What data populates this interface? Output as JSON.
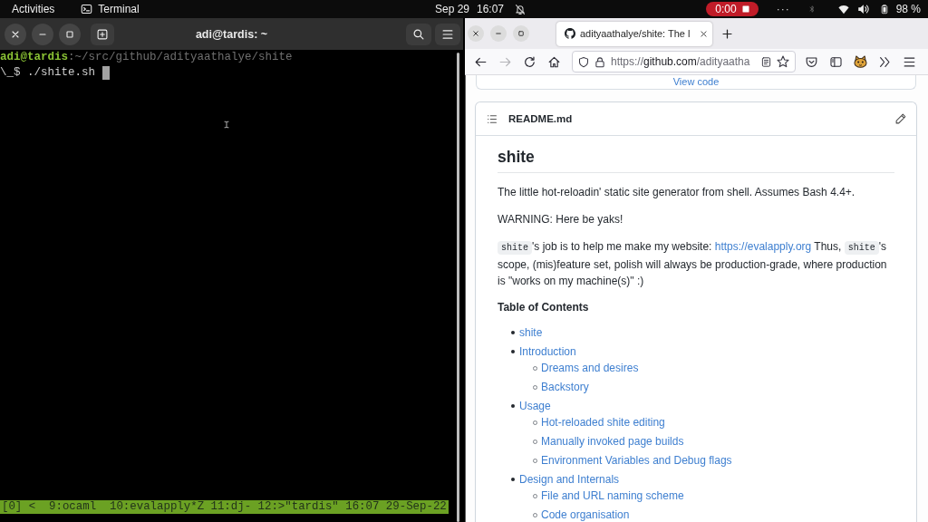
{
  "top_bar": {
    "activities": "Activities",
    "app_menu": "Terminal",
    "date": "Sep 29",
    "time": "16:07",
    "screencast": "0:00",
    "overflow": "···",
    "battery": "98 %"
  },
  "terminal": {
    "title": "adi@tardis: ~",
    "lines": [
      {
        "kind": "prompt",
        "text": "**adi@tardis**:~/src/github/adityaathalye/shite"
      },
      {
        "kind": "command",
        "text": "\\_$ ./shite.sh"
      }
    ],
    "status_bar": "[0] <  9:ocaml  10:evalapply*Z 11:dj- 12:>\"tardis\" 16:07 29-Sep-22"
  },
  "browser": {
    "tabs": [
      {
        "title": "adityaathalye/shite: The l",
        "selected": true
      }
    ],
    "nav": {
      "back": {
        "disabled": false
      },
      "forward": {
        "disabled": true
      }
    },
    "url": {
      "scheme": "https://",
      "host": "github.com",
      "path": "/adityaatha"
    },
    "previous_card_link": "View code",
    "readme": {
      "file_name": "README.md",
      "title": "shite",
      "blocks": [
        {
          "kind": "paragraph",
          "text": "The little hot-reloadin' static site generator from shell. Assumes Bash 4.4+."
        },
        {
          "kind": "paragraph",
          "text": "WARNING: Here be yaks!"
        },
        {
          "kind": "mixed_paragraph",
          "parts": [
            {
              "kind": "code",
              "text": "shite"
            },
            {
              "kind": "text",
              "text": "'s job is to help me make my website: "
            },
            {
              "kind": "link",
              "text": "https://evalapply.org"
            },
            {
              "kind": "text",
              "text": " Thus, "
            },
            {
              "kind": "code",
              "text": "shite"
            },
            {
              "kind": "text",
              "text": "'s scope, (mis)feature set, polish will always be production-grade, where production is \"works on my machine(s)\" :)"
            }
          ]
        },
        {
          "kind": "heading",
          "text": "Table of Contents"
        },
        {
          "kind": "toc",
          "items": [
            {
              "text": "shite"
            },
            {
              "text": "Introduction",
              "children": [
                {
                  "text": "Dreams and desires"
                },
                {
                  "text": "Backstory"
                }
              ]
            },
            {
              "text": "Usage",
              "children": [
                {
                  "text": "Hot-reloaded shite editing"
                },
                {
                  "text": "Manually invoked page builds"
                },
                {
                  "text": "Environment Variables and Debug flags"
                }
              ]
            },
            {
              "text": "Design and Internals",
              "children": [
                {
                  "text": "File and URL naming scheme"
                },
                {
                  "text": "Code organisation"
                }
              ]
            }
          ]
        }
      ]
    }
  }
}
